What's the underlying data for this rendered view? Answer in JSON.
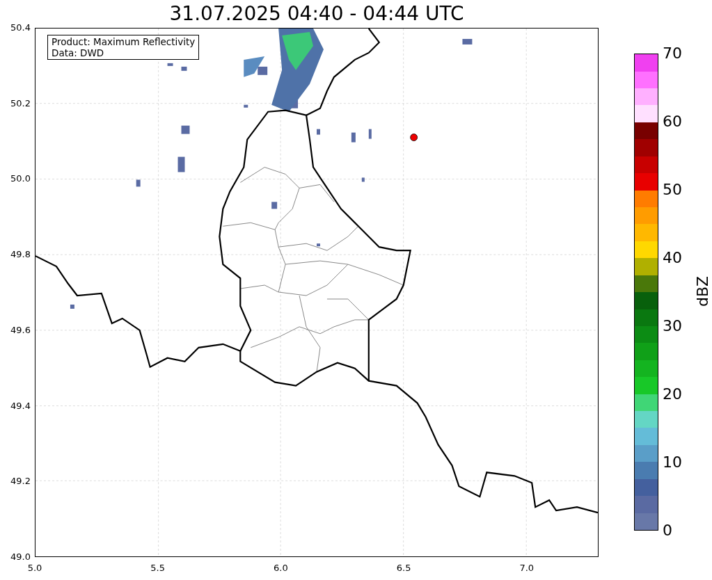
{
  "title": "31.07.2025 04:40 - 04:44 UTC",
  "info_box": [
    "Product: Maximum Reflectivity",
    "Data: DWD"
  ],
  "x_ticks": [
    "5.0",
    "5.5",
    "6.0",
    "6.5",
    "7.0"
  ],
  "y_ticks": [
    "50.4",
    "50.2",
    "50.0",
    "49.8",
    "49.6",
    "49.4",
    "49.2",
    "49.0"
  ],
  "colorbar": {
    "label": "dBZ",
    "ticks": [
      "70",
      "60",
      "50",
      "40",
      "30",
      "20",
      "10",
      "0"
    ],
    "bands": [
      {
        "color": "#6878a8"
      },
      {
        "color": "#5a6aa2"
      },
      {
        "color": "#44609e"
      },
      {
        "color": "#4a7cb0"
      },
      {
        "color": "#5a9ec8"
      },
      {
        "color": "#64bcd8"
      },
      {
        "color": "#64d6c4"
      },
      {
        "color": "#40d676"
      },
      {
        "color": "#18c828"
      },
      {
        "color": "#14b420"
      },
      {
        "color": "#10a018"
      },
      {
        "color": "#0c8c14"
      },
      {
        "color": "#0a7810"
      },
      {
        "color": "#08600c"
      },
      {
        "color": "#4a780a"
      },
      {
        "color": "#b0b000"
      },
      {
        "color": "#ffd800"
      },
      {
        "color": "#ffb800"
      },
      {
        "color": "#ff9c00"
      },
      {
        "color": "#ff7c00"
      },
      {
        "color": "#e80000"
      },
      {
        "color": "#c80000"
      },
      {
        "color": "#a00000"
      },
      {
        "color": "#780000"
      },
      {
        "color": "#ffe0ff"
      },
      {
        "color": "#ffb0ff"
      },
      {
        "color": "#ff70ff"
      },
      {
        "color": "#f040f0"
      }
    ]
  }
}
